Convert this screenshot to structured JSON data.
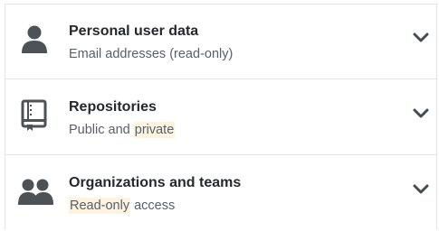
{
  "permissions": [
    {
      "title": "Personal user data",
      "desc_parts": [
        "Email addresses (read-only)"
      ],
      "highlight_index": -1,
      "icon": "person-icon"
    },
    {
      "title": "Repositories",
      "desc_before": "Public and ",
      "desc_highlight": "private",
      "desc_after": "",
      "icon": "repo-book-icon"
    },
    {
      "title": "Organizations and teams",
      "desc_before": "",
      "desc_highlight": "Read-only",
      "desc_after": " access",
      "icon": "people-icon"
    }
  ],
  "row0_desc": "Email addresses (read-only)",
  "colors": {
    "title": "#24292e",
    "desc": "#586069",
    "icon": "#4d5257",
    "highlight": "#fdf3e0",
    "border": "#e1e4e8"
  }
}
